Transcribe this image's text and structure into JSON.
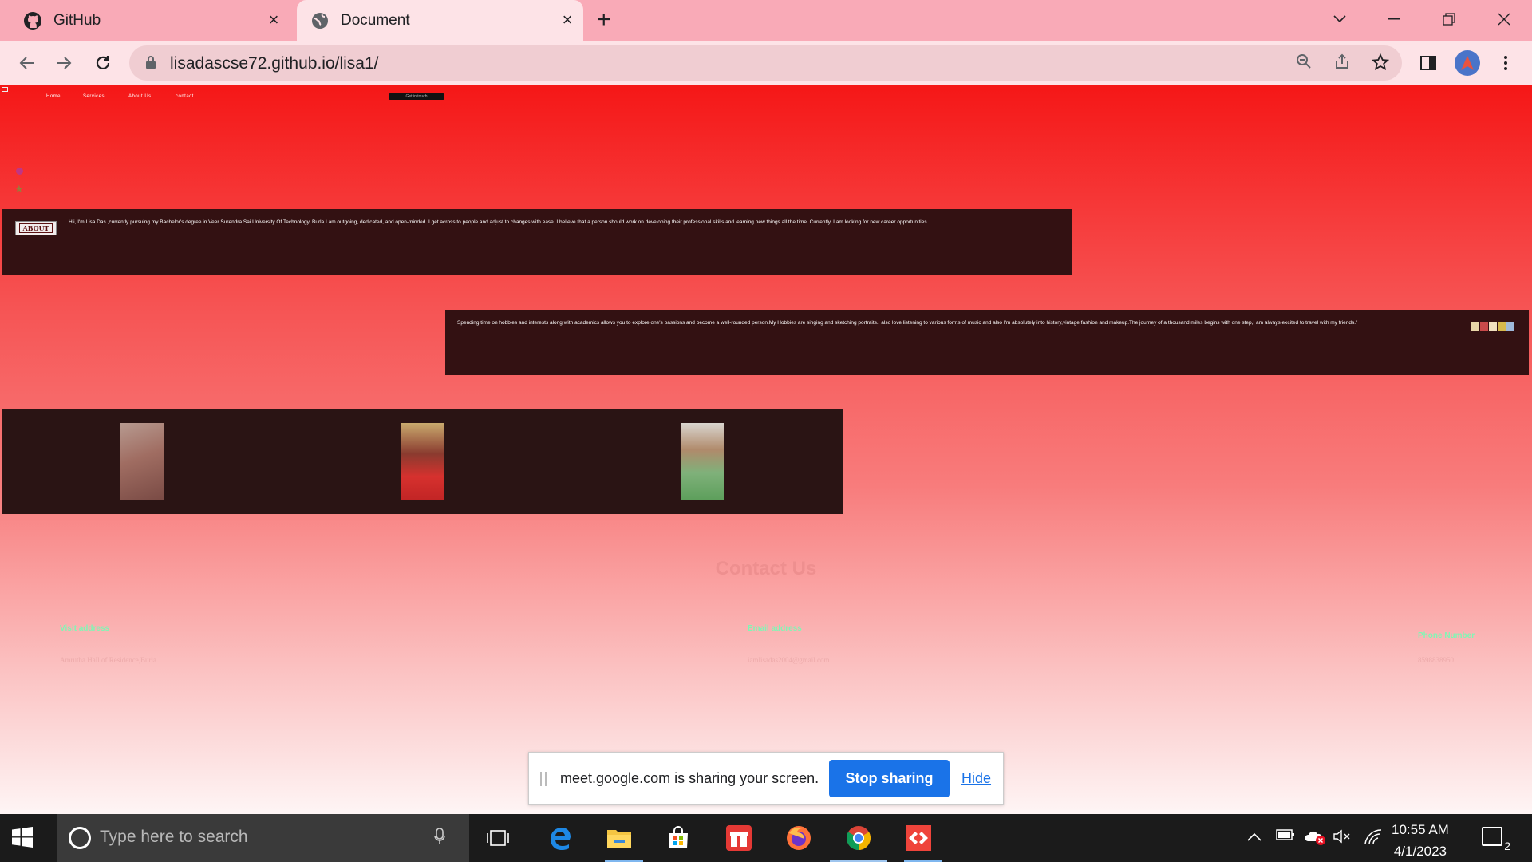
{
  "browser": {
    "tabs": [
      {
        "title": "GitHub",
        "icon": "github-icon",
        "active": false
      },
      {
        "title": "Document",
        "icon": "globe-icon",
        "active": true
      }
    ],
    "url": "lisadascse72.github.io/lisa1/"
  },
  "site": {
    "nav": [
      "Home",
      "Services",
      "About Us",
      "contact"
    ],
    "get_button": "Get in touch",
    "about_logo": "ABOUT",
    "about_text": "Hii, I'm Lisa Das ,currently pursuing my Bachelor's degree in Veer Surendra Sai University Of Technology, Burla.I am outgoing, dedicated, and open-minded. I get across to people and adjust to changes with ease. I believe that a person should work on developing their professional skills and learning new things all the time. Currently, I am looking for new career opportunities.",
    "hobby_text": "Spending time on hobbies and interests along with academics allows you to explore one's passions and become a well-rounded person.My Hobbies are singing and sketching portraits.I also love listening to various forms of music and also I'm absolutely into history,vintage fashion and makeup.The journey of a thousand miles begins with one step,I am always excited to travel with my friends.\"",
    "contact_title": "Contact Us",
    "contacts": [
      {
        "label": "Visit address",
        "value": "Amrutha Hall of Residence,Burla"
      },
      {
        "label": "Email address",
        "value": "iamlisadas2004@gmail.com"
      },
      {
        "label": "Phone Number",
        "value": "8598838950"
      }
    ]
  },
  "share": {
    "message": "meet.google.com is sharing your screen.",
    "stop_label": "Stop sharing",
    "hide_label": "Hide"
  },
  "taskbar": {
    "search_placeholder": "Type here to search",
    "time": "10:55 AM",
    "date": "4/1/2023",
    "notification_count": "2"
  },
  "colors": {
    "accent_blue": "#1a73e8",
    "page_top": "#f51717",
    "box_bg": "#331112",
    "contact_label": "#7ff7b5"
  }
}
